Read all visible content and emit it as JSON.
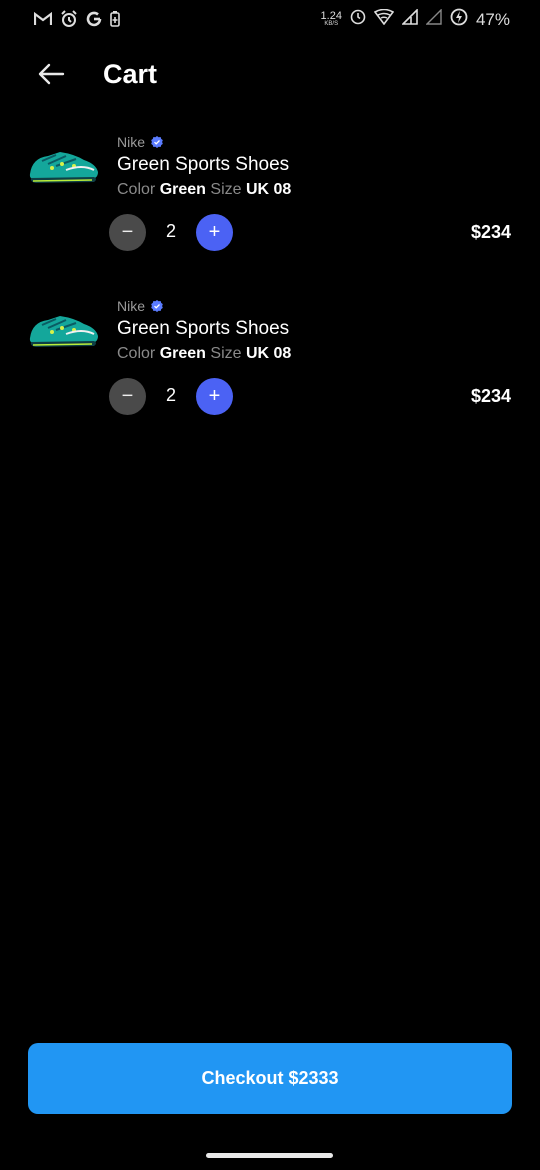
{
  "status_bar": {
    "left_icons": [
      "gmail-icon",
      "alarm-icon",
      "google-icon",
      "battery-saver-icon"
    ],
    "net_speed_value": "1.24",
    "net_speed_unit": "KB/S",
    "right_icons": [
      "timer-icon",
      "wifi-icon",
      "signal-icon",
      "signal-icon-2",
      "charging-icon"
    ],
    "battery_percent": "47%"
  },
  "header": {
    "title": "Cart"
  },
  "cart": {
    "items": [
      {
        "brand": "Nike",
        "name": "Green Sports Shoes",
        "color_label": "Color",
        "color_value": "Green",
        "size_label": "Size",
        "size_value": "UK 08",
        "quantity": "2",
        "minus": "−",
        "plus": "+",
        "price": "$234"
      },
      {
        "brand": "Nike",
        "name": "Green Sports Shoes",
        "color_label": "Color",
        "color_value": "Green",
        "size_label": "Size",
        "size_value": "UK 08",
        "quantity": "2",
        "minus": "−",
        "plus": "+",
        "price": "$234"
      }
    ]
  },
  "checkout": {
    "label": "Checkout $2333"
  },
  "colors": {
    "accent": "#4b62f4",
    "checkout": "#2196f3",
    "background": "#000000",
    "verified": "#5b7cff"
  }
}
